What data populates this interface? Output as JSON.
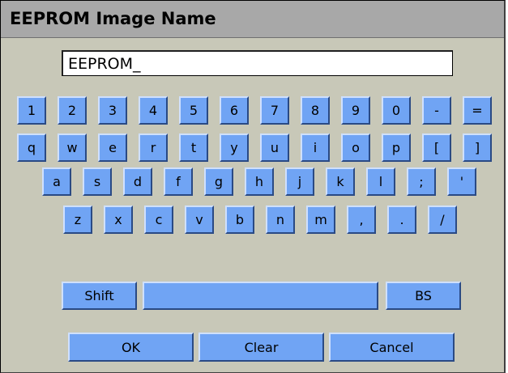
{
  "title": "EEPROM Image Name",
  "input": {
    "value": "EEPROM_"
  },
  "rows": {
    "numbers": [
      "1",
      "2",
      "3",
      "4",
      "5",
      "6",
      "7",
      "8",
      "9",
      "0",
      "-",
      "="
    ],
    "top": [
      "q",
      "w",
      "e",
      "r",
      "t",
      "y",
      "u",
      "i",
      "o",
      "p",
      "[",
      "]"
    ],
    "home": [
      "a",
      "s",
      "d",
      "f",
      "g",
      "h",
      "j",
      "k",
      "l",
      ";",
      "'"
    ],
    "bottom": [
      "z",
      "x",
      "c",
      "v",
      "b",
      "n",
      "m",
      ",",
      ".",
      "/"
    ]
  },
  "special": {
    "shift": "Shift",
    "space": "",
    "backspace": "BS"
  },
  "actions": {
    "ok": "OK",
    "clear": "Clear",
    "cancel": "Cancel"
  },
  "colors": {
    "dialog_bg": "#c8c8b8",
    "titlebar_bg": "#a8a8a8",
    "key_face": "#70a4f4",
    "key_highlight": "#cfe0ff",
    "key_shadow": "#2a4a84"
  }
}
